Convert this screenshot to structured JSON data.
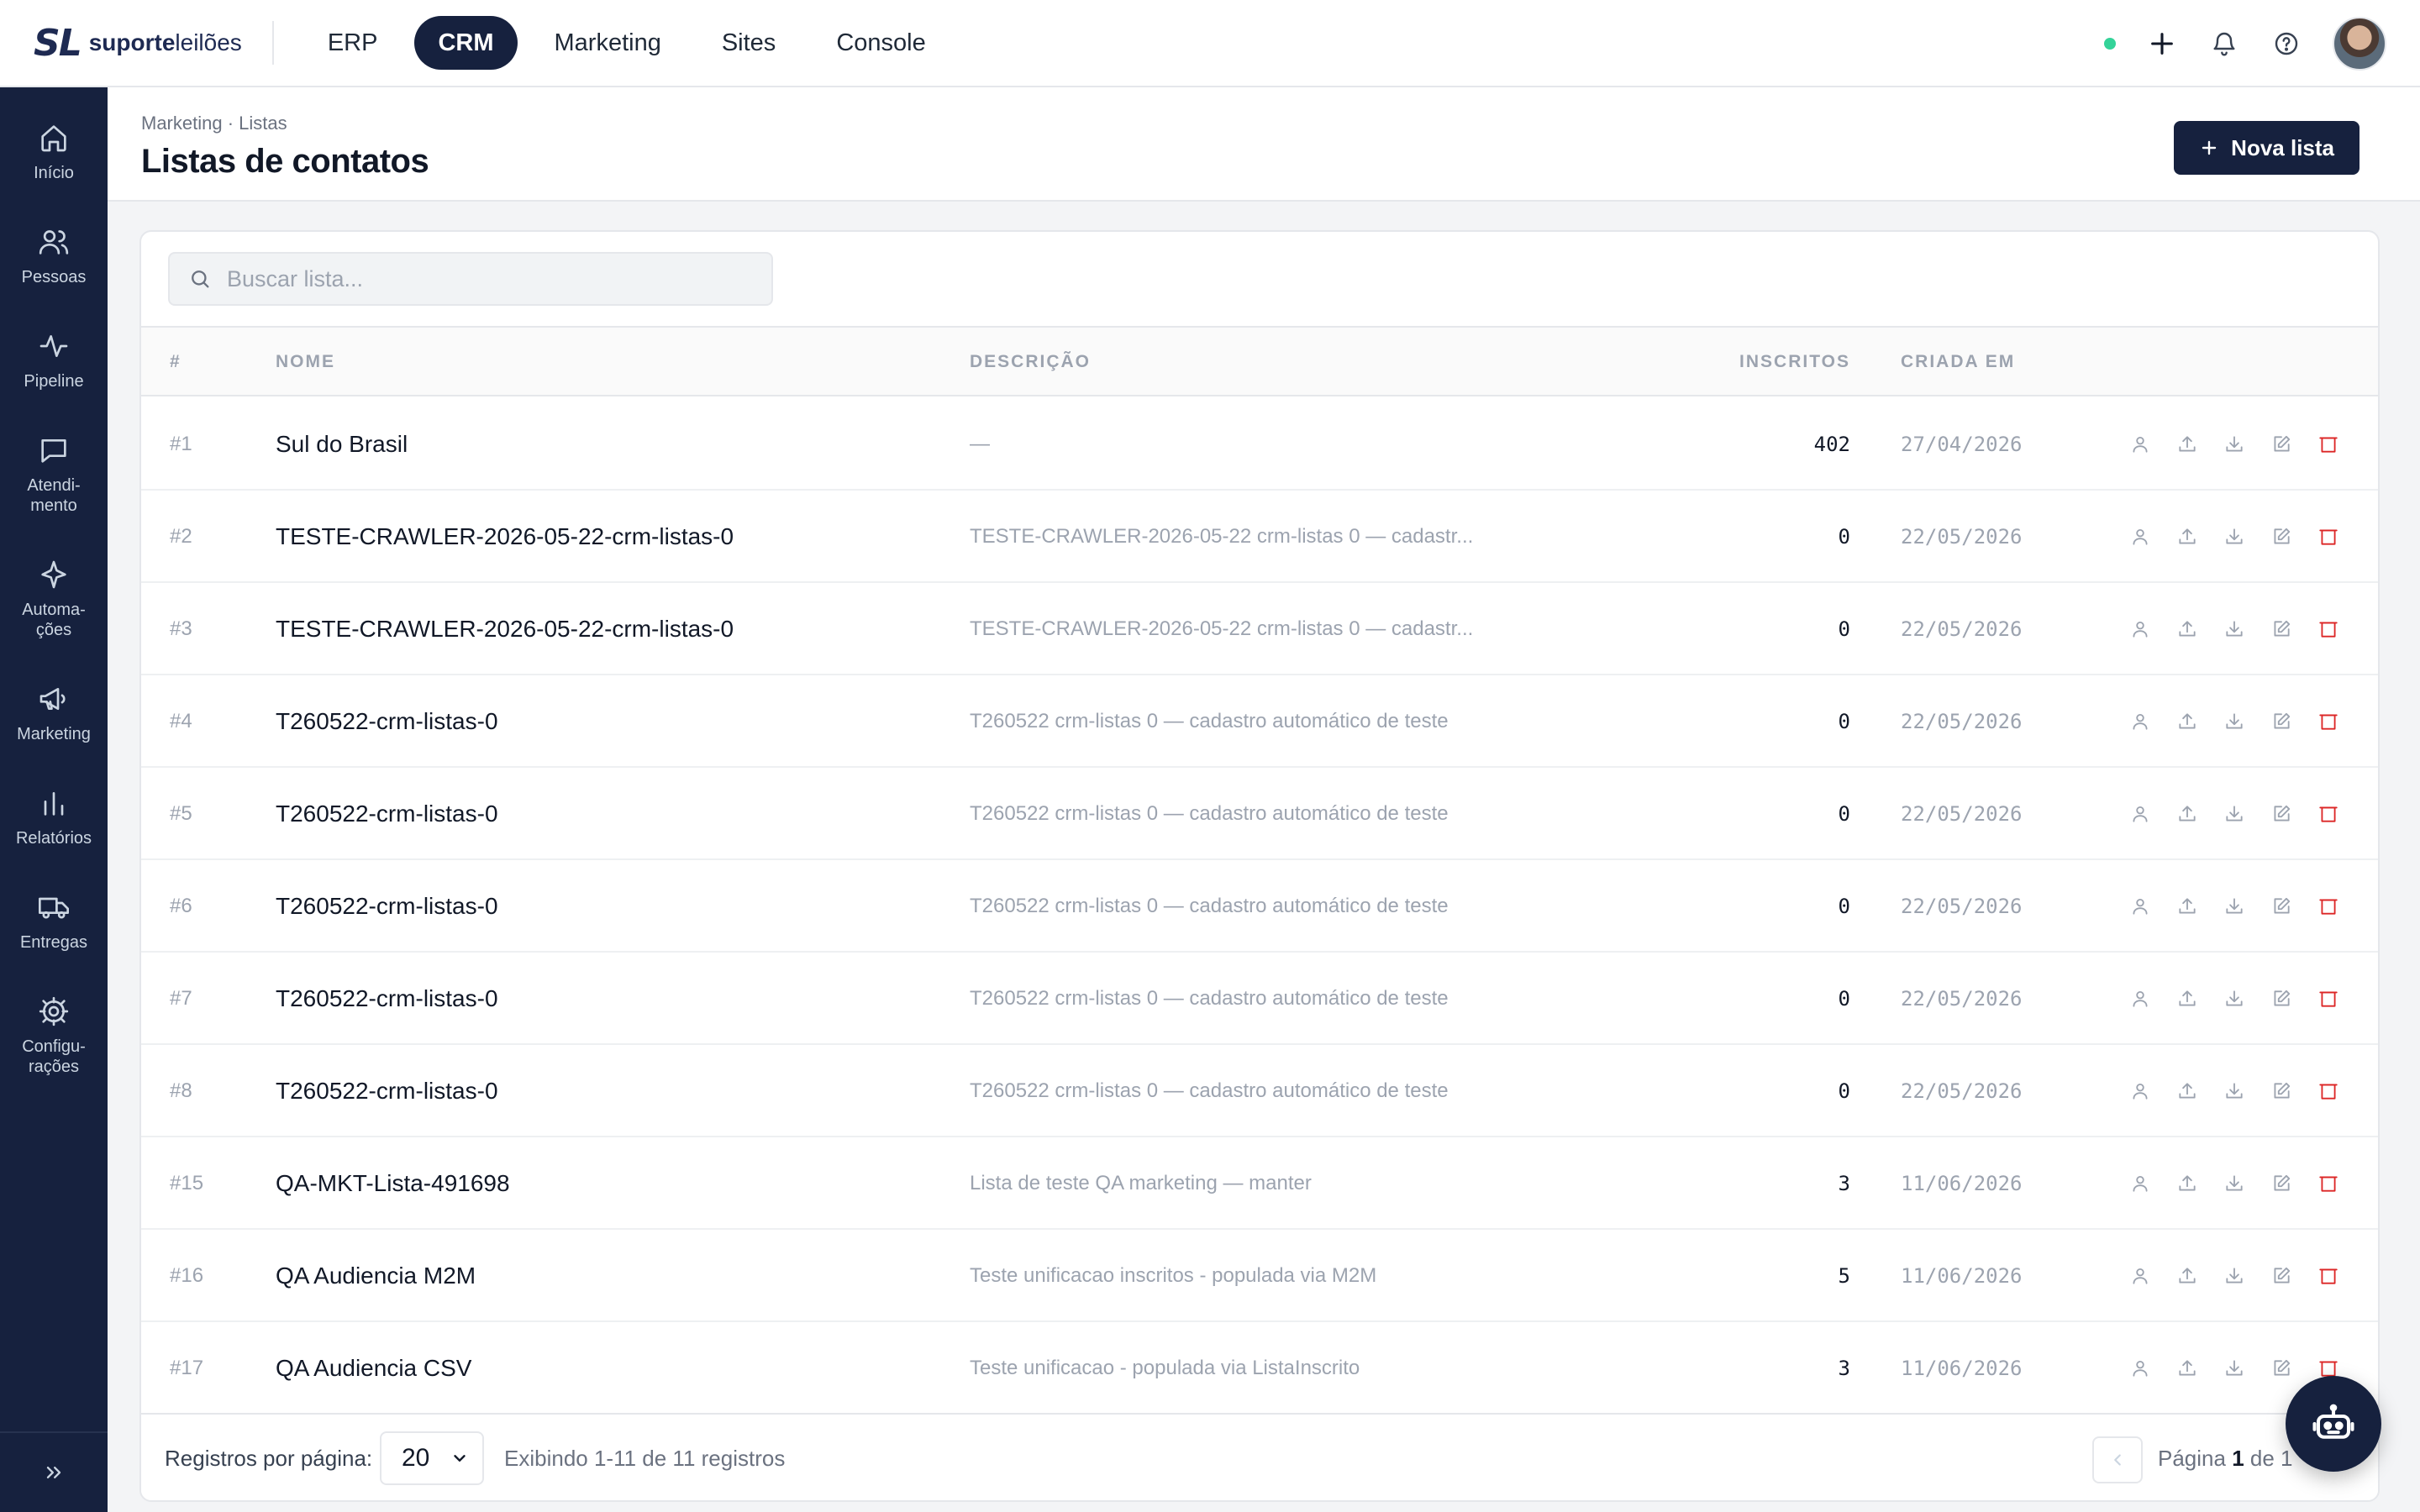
{
  "brand": {
    "mark": "SL",
    "name_bold": "suporte",
    "name_light": "leilões"
  },
  "topnav": [
    {
      "label": "ERP",
      "active": false
    },
    {
      "label": "CRM",
      "active": true
    },
    {
      "label": "Marketing",
      "active": false
    },
    {
      "label": "Sites",
      "active": false
    },
    {
      "label": "Console",
      "active": false
    }
  ],
  "sidebar": [
    {
      "label": "Início",
      "icon": "home-icon"
    },
    {
      "label": "Pessoas",
      "icon": "users-icon"
    },
    {
      "label": "Pipeline",
      "icon": "activity-icon"
    },
    {
      "label": "Atendi-\nmento",
      "icon": "chat-icon"
    },
    {
      "label": "Automa-\nções",
      "icon": "sparkle-icon"
    },
    {
      "label": "Marketing",
      "icon": "megaphone-icon"
    },
    {
      "label": "Relatórios",
      "icon": "bar-chart-icon"
    },
    {
      "label": "Entregas",
      "icon": "truck-icon"
    },
    {
      "label": "Configu-\nrações",
      "icon": "gear-icon"
    }
  ],
  "header": {
    "breadcrumb": "Marketing · Listas",
    "title": "Listas de contatos",
    "new_button": "Nova lista"
  },
  "search": {
    "placeholder": "Buscar lista..."
  },
  "table": {
    "columns": {
      "num": "#",
      "name": "NOME",
      "desc": "DESCRIÇÃO",
      "inscritos": "INSCRITOS",
      "created": "CRIADA EM"
    },
    "rows": [
      {
        "num": "#1",
        "name": "Sul do Brasil",
        "desc": "—",
        "inscritos": "402",
        "created": "27/04/2026"
      },
      {
        "num": "#2",
        "name": "TESTE-CRAWLER-2026-05-22-crm-listas-0",
        "desc": "TESTE-CRAWLER-2026-05-22 crm-listas 0 — cadastr...",
        "inscritos": "0",
        "created": "22/05/2026"
      },
      {
        "num": "#3",
        "name": "TESTE-CRAWLER-2026-05-22-crm-listas-0",
        "desc": "TESTE-CRAWLER-2026-05-22 crm-listas 0 — cadastr...",
        "inscritos": "0",
        "created": "22/05/2026"
      },
      {
        "num": "#4",
        "name": "T260522-crm-listas-0",
        "desc": "T260522 crm-listas 0 — cadastro automático de teste",
        "inscritos": "0",
        "created": "22/05/2026"
      },
      {
        "num": "#5",
        "name": "T260522-crm-listas-0",
        "desc": "T260522 crm-listas 0 — cadastro automático de teste",
        "inscritos": "0",
        "created": "22/05/2026"
      },
      {
        "num": "#6",
        "name": "T260522-crm-listas-0",
        "desc": "T260522 crm-listas 0 — cadastro automático de teste",
        "inscritos": "0",
        "created": "22/05/2026"
      },
      {
        "num": "#7",
        "name": "T260522-crm-listas-0",
        "desc": "T260522 crm-listas 0 — cadastro automático de teste",
        "inscritos": "0",
        "created": "22/05/2026"
      },
      {
        "num": "#8",
        "name": "T260522-crm-listas-0",
        "desc": "T260522 crm-listas 0 — cadastro automático de teste",
        "inscritos": "0",
        "created": "22/05/2026"
      },
      {
        "num": "#15",
        "name": "QA-MKT-Lista-491698",
        "desc": "Lista de teste QA marketing — manter",
        "inscritos": "3",
        "created": "11/06/2026"
      },
      {
        "num": "#16",
        "name": "QA Audiencia M2M",
        "desc": "Teste unificacao inscritos - populada via M2M",
        "inscritos": "5",
        "created": "11/06/2026"
      },
      {
        "num": "#17",
        "name": "QA Audiencia CSV",
        "desc": "Teste unificacao - populada via ListaInscrito",
        "inscritos": "3",
        "created": "11/06/2026"
      }
    ]
  },
  "footer": {
    "per_page_label": "Registros por página:",
    "per_page_value": "20",
    "showing": "Exibindo 1-11 de 11 registros",
    "page_prefix": "Página",
    "page_current": "1",
    "page_of": "de 1"
  },
  "colors": {
    "navy": "#16213e",
    "danger": "#dc2626",
    "online": "#34d399"
  }
}
